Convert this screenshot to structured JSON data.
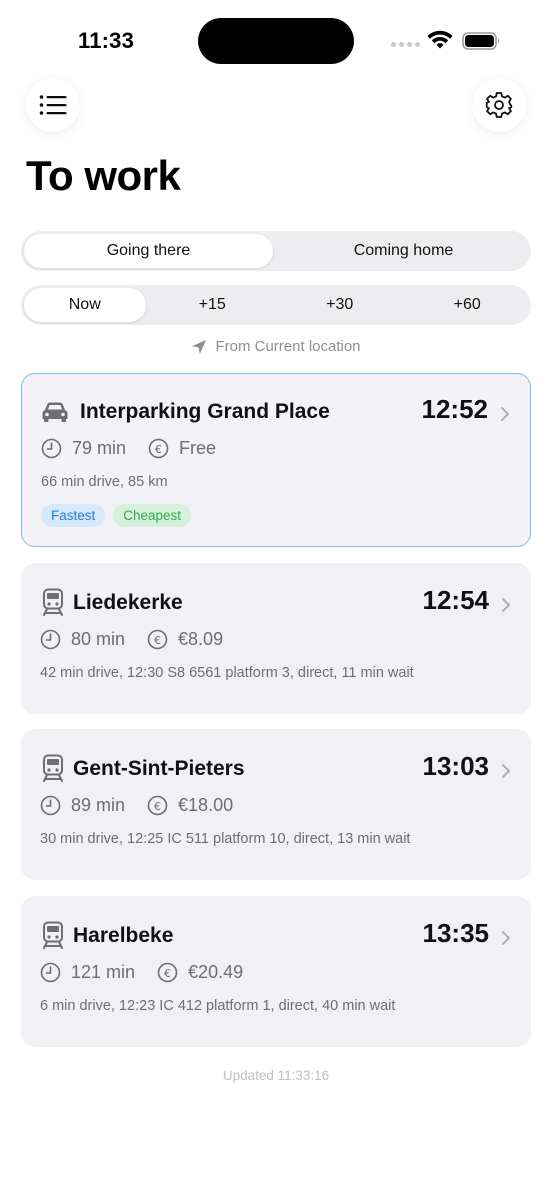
{
  "status_bar": {
    "time": "11:33"
  },
  "header": {
    "title": "To work",
    "menu_icon": "list-icon",
    "settings_icon": "gear-icon"
  },
  "direction_tabs": [
    {
      "label": "Going there",
      "active": true
    },
    {
      "label": "Coming home",
      "active": false
    }
  ],
  "time_tabs": [
    {
      "label": "Now",
      "active": true
    },
    {
      "label": "+15",
      "active": false
    },
    {
      "label": "+30",
      "active": false
    },
    {
      "label": "+60",
      "active": false
    }
  ],
  "origin": {
    "label": "From Current location",
    "icon": "location-arrow-icon"
  },
  "routes": [
    {
      "mode": "car",
      "name": "Interparking Grand Place",
      "arrival": "12:52",
      "duration": "79 min",
      "cost": "Free",
      "detail": "66 min drive, 85 km",
      "tags": [
        "Fastest",
        "Cheapest"
      ],
      "selected": true
    },
    {
      "mode": "train",
      "name": "Liedekerke",
      "arrival": "12:54",
      "duration": "80 min",
      "cost": "€8.09",
      "detail": "42 min drive, 12:30 S8 6561 platform 3, direct, 11 min wait",
      "selected": false
    },
    {
      "mode": "train",
      "name": "Gent-Sint-Pieters",
      "arrival": "13:03",
      "duration": "89 min",
      "cost": "€18.00",
      "detail": "30 min drive, 12:25 IC 511 platform 10, direct, 13 min wait",
      "selected": false
    },
    {
      "mode": "train",
      "name": "Harelbeke",
      "arrival": "13:35",
      "duration": "121 min",
      "cost": "€20.49",
      "detail": "6 min drive, 12:23 IC 412 platform 1, direct, 40 min wait",
      "selected": false
    }
  ],
  "footer": {
    "updated": "Updated 11:33:16"
  },
  "colors": {
    "accent_border": "#7fbfe8",
    "tag_blue": "#2b7bd6",
    "tag_green": "#2fa84f",
    "card_bg": "#f1f1f5"
  }
}
